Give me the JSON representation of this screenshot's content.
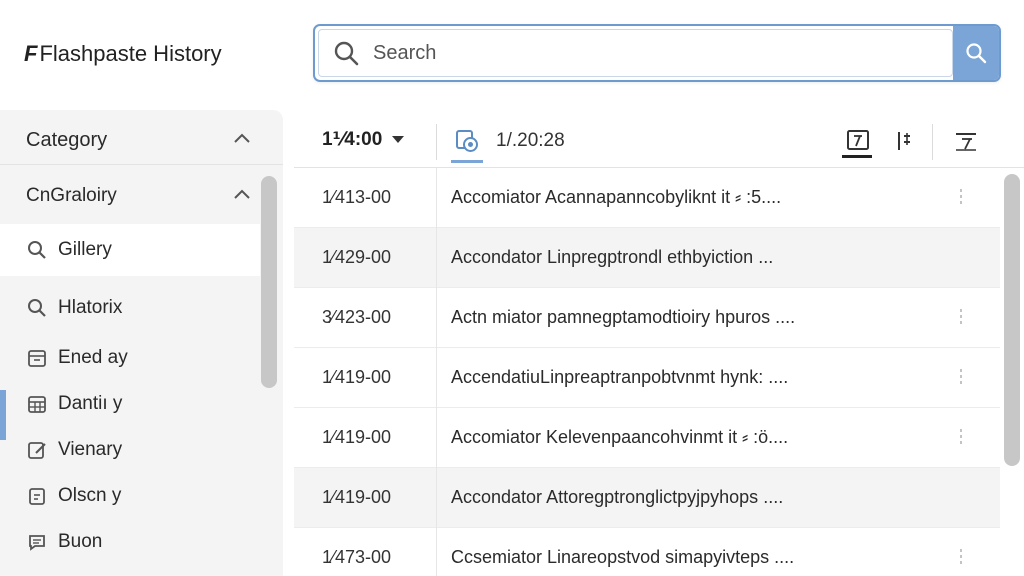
{
  "app": {
    "title": "Flashpaste History",
    "logo_glyph": "F"
  },
  "search": {
    "placeholder": "Search",
    "accent_color": "#7aa5d6"
  },
  "sidebar": {
    "sections": [
      {
        "label": "Category"
      },
      {
        "label": "CnGraloiry"
      }
    ],
    "items": [
      {
        "label": "Gillery",
        "icon": "search-icon"
      },
      {
        "label": "Hlatorix",
        "icon": "search-icon"
      },
      {
        "label": "Ened ay",
        "icon": "calendar-icon"
      },
      {
        "label": "Dantiı y",
        "icon": "grid-calendar-icon"
      },
      {
        "label": "Vienary",
        "icon": "edit-note-icon"
      },
      {
        "label": "Olscn y",
        "icon": "document-icon"
      },
      {
        "label": "Buon",
        "icon": "chat-icon"
      }
    ]
  },
  "toolbar": {
    "time_filter": "1⅟4:00",
    "time_secondary": "1/.20:28"
  },
  "history": {
    "rows": [
      {
        "time": "1⁄413-00",
        "text": "Accomiator Acannapanncobyliknt it ⸗ :5....",
        "more": true
      },
      {
        "time": "1⁄429-00",
        "text": "Accondator Linpregptrondl ethbyiction ...",
        "more": false
      },
      {
        "time": "3⁄423-00",
        "text": "Actn miator pamnegptamodtioiry hpuros ....",
        "more": true
      },
      {
        "time": "1⁄419-00",
        "text": "AccendatiuLinpreaptranpobtvnmt hynk: ....",
        "more": true
      },
      {
        "time": "1⁄419-00",
        "text": "Accomiator Kelevenpaancohvinmt it ⸗ :ö....",
        "more": true
      },
      {
        "time": "1⁄419-00",
        "text": "Accondator Attoregptronglictpyjpyhops ....",
        "more": false
      },
      {
        "time": "1⁄473-00",
        "text": "Ccsemiator Linareopstvod simapyivteps ....",
        "more": true
      }
    ]
  }
}
